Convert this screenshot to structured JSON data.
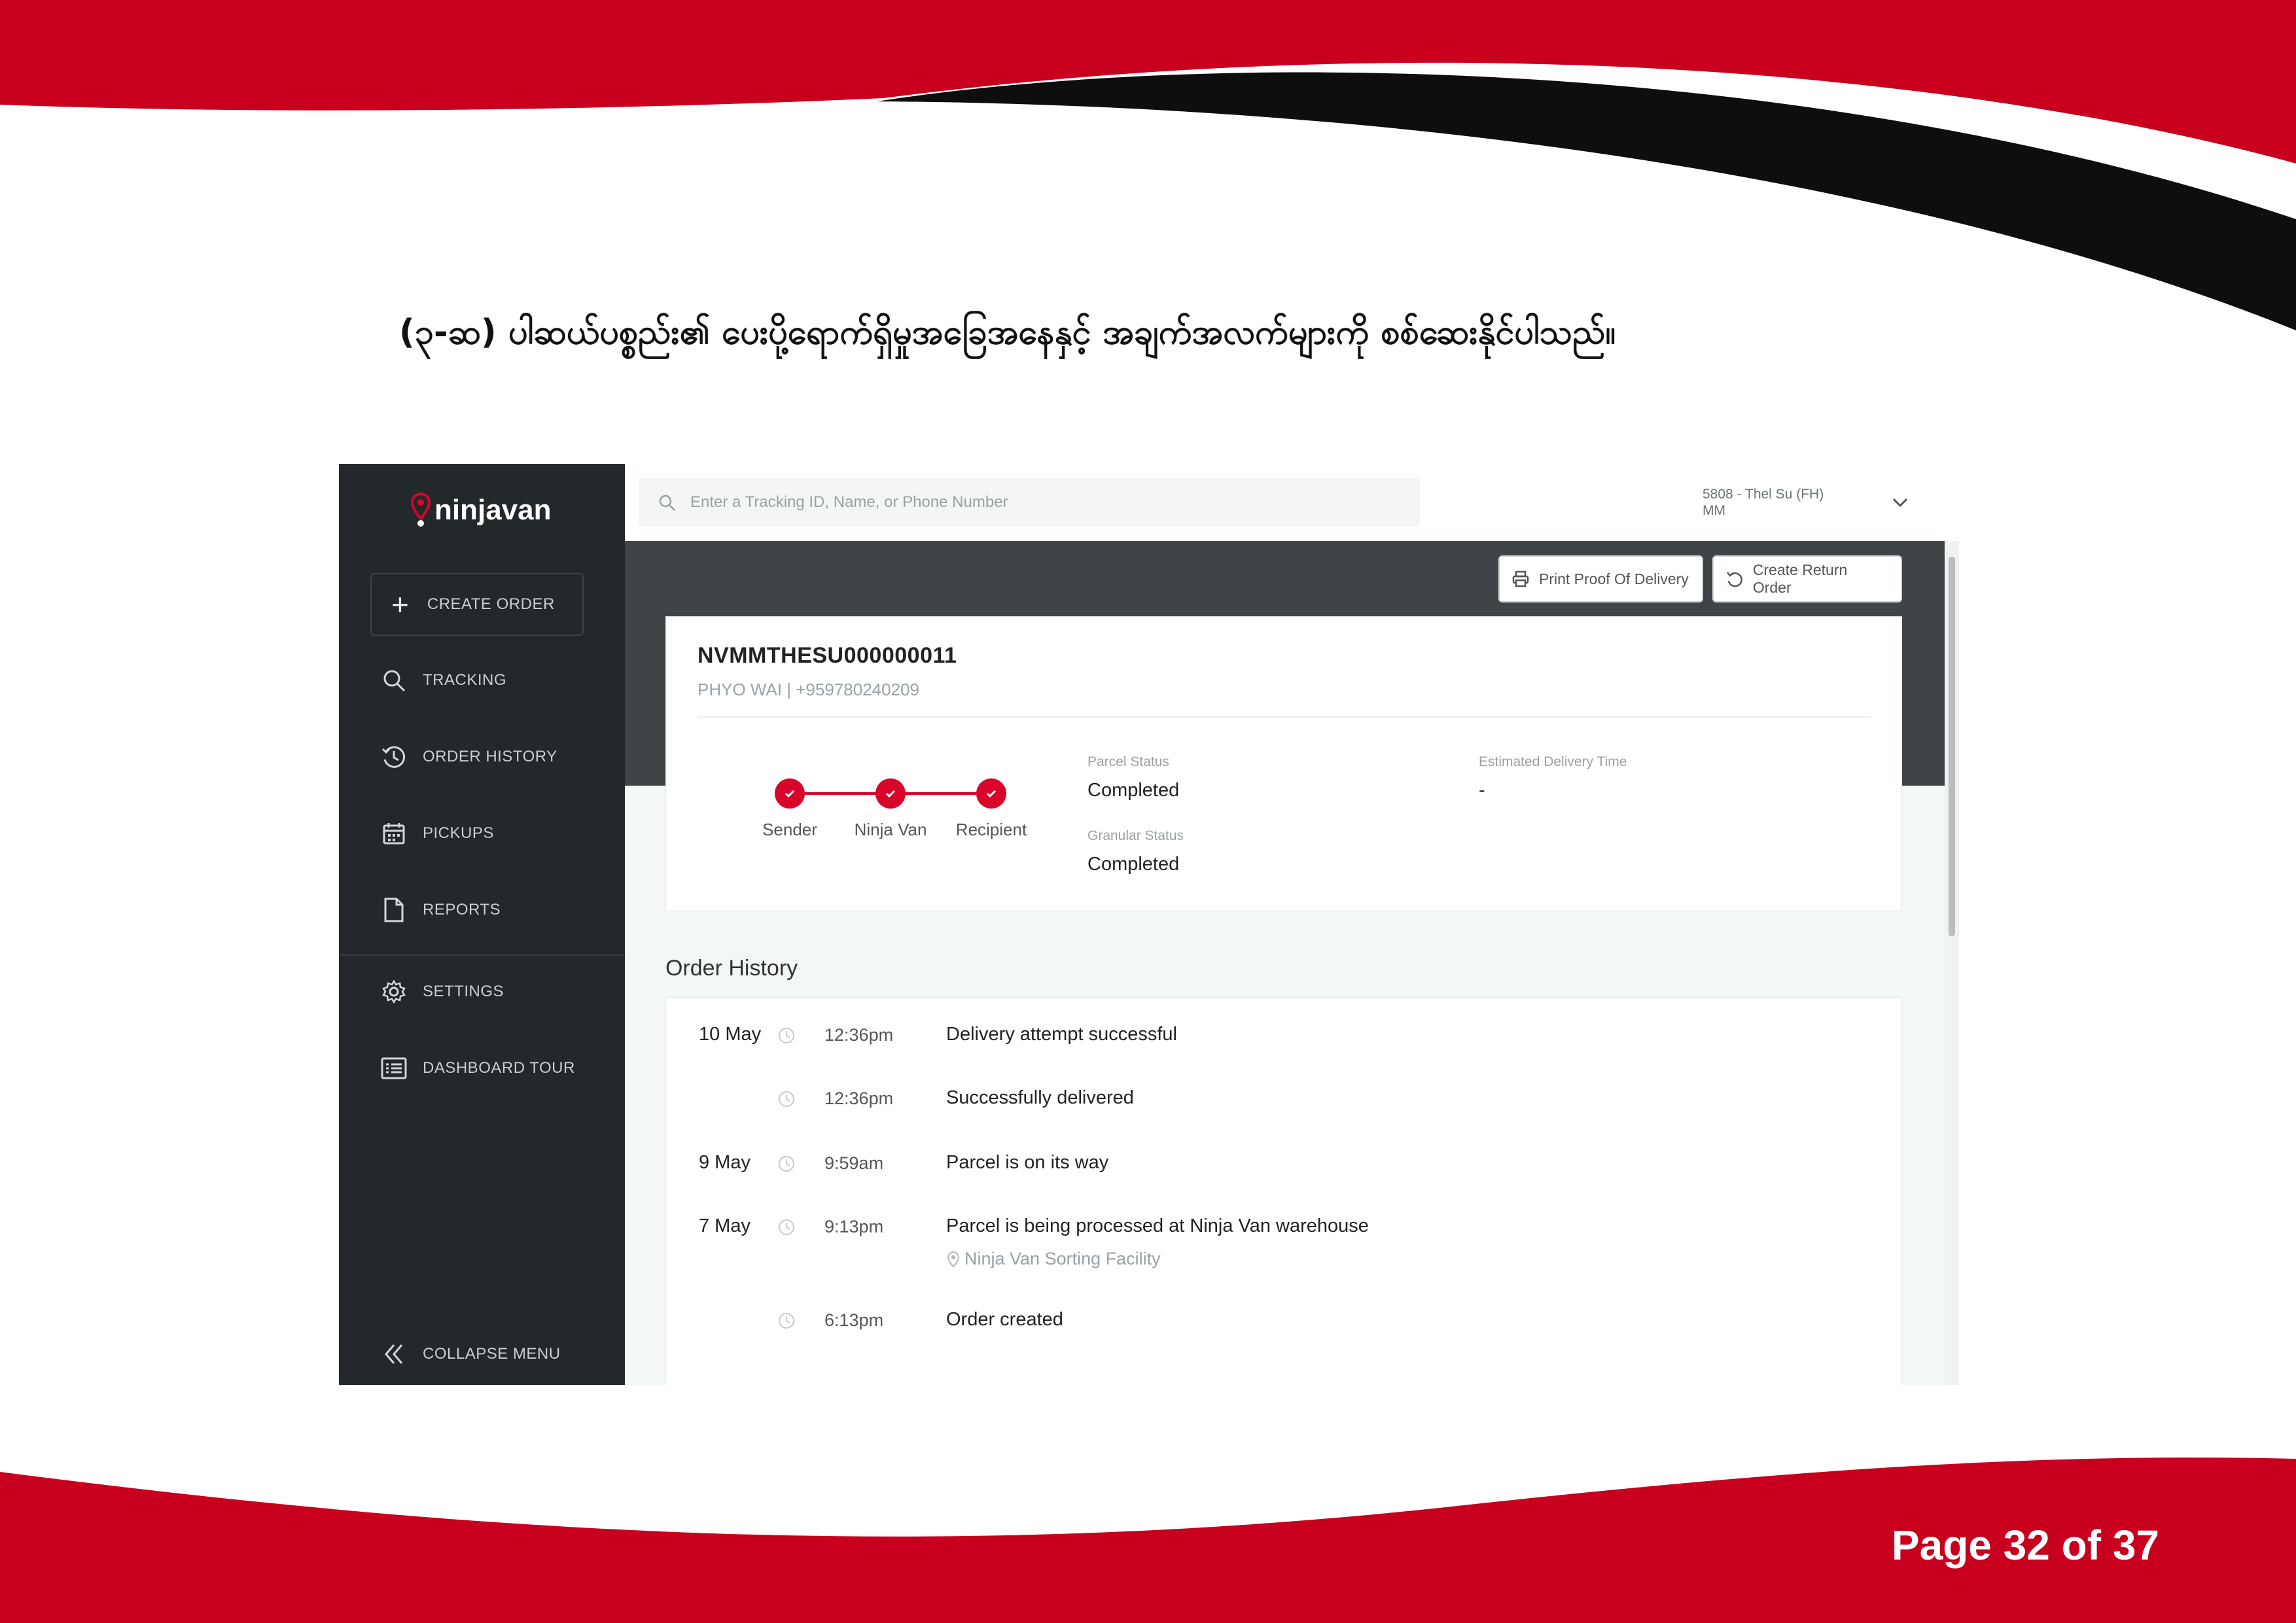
{
  "instruction": {
    "text": "(၃-ဆ) ပါဆယ်ပစ္စည်း၏ ပေးပို့ရောက်ရှိမှုအခြေအနေနှင့် အချက်အလက်များကို စစ်ဆေးနိုင်ပါသည်။"
  },
  "footer": {
    "page_label": "Page 32 of 37"
  },
  "colors": {
    "brand_red": "#c8001e",
    "sidebar": "#23282a",
    "accent_red": "#d90429"
  },
  "app": {
    "logo": "ninjavan",
    "search": {
      "placeholder": "Enter a Tracking ID, Name, or Phone Number"
    },
    "account": {
      "line1": "5808 - Thel Su (FH)",
      "line2": "MM"
    },
    "sidebar": {
      "create_order": "CREATE ORDER",
      "items": [
        {
          "label": "TRACKING",
          "icon": "search-icon"
        },
        {
          "label": "ORDER HISTORY",
          "icon": "history-icon"
        },
        {
          "label": "PICKUPS",
          "icon": "calendar-icon"
        },
        {
          "label": "REPORTS",
          "icon": "document-icon"
        },
        {
          "label": "SETTINGS",
          "icon": "gear-icon"
        },
        {
          "label": "DASHBOARD TOUR",
          "icon": "list-icon"
        }
      ],
      "collapse": "COLLAPSE MENU"
    },
    "actions": {
      "print": "Print Proof Of Delivery",
      "return": "Create Return Order"
    },
    "order": {
      "tracking_id": "NVMMTHESU000000011",
      "recipient": "PHYO WAI | +959780240209",
      "steps": [
        "Sender",
        "Ninja Van",
        "Recipient"
      ],
      "parcel_status_label": "Parcel Status",
      "parcel_status": "Completed",
      "granular_status_label": "Granular Status",
      "granular_status": "Completed",
      "eta_label": "Estimated Delivery Time",
      "eta": "-"
    },
    "history": {
      "title": "Order History",
      "events": [
        {
          "date": "10 May",
          "time": "12:36pm",
          "text": "Delivery attempt successful",
          "location": ""
        },
        {
          "date": "",
          "time": "12:36pm",
          "text": "Successfully delivered",
          "location": ""
        },
        {
          "date": "9 May",
          "time": "9:59am",
          "text": "Parcel is on its way",
          "location": ""
        },
        {
          "date": "7 May",
          "time": "9:13pm",
          "text": "Parcel is being processed at Ninja Van warehouse",
          "location": "Ninja Van Sorting Facility"
        },
        {
          "date": "",
          "time": "6:13pm",
          "text": "Order created",
          "location": ""
        }
      ]
    }
  }
}
